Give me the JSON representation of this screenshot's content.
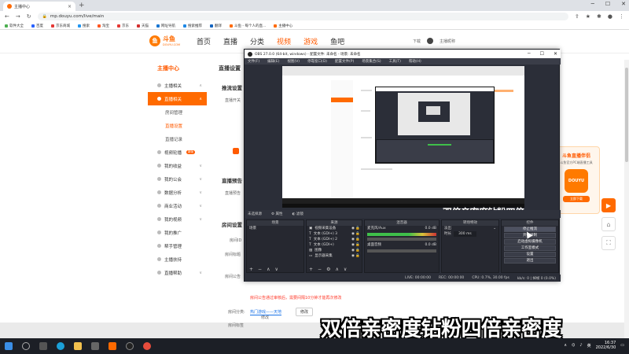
{
  "browser": {
    "tab_title": "主播中心",
    "url": "mp.douyu.com/live/main",
    "bookmarks": [
      "软件大全",
      "百度",
      "京东商城",
      "搜索",
      "淘宝",
      "京东",
      "天猫",
      "网址导航",
      "搜索推荐",
      "翻译",
      "斗鱼 - 每个人的直...",
      "主播中心"
    ]
  },
  "site": {
    "logo_text": "斗鱼",
    "logo_sub": "DOUYU.COM",
    "nav": [
      "首页",
      "直播",
      "分类",
      "视频",
      "游戏",
      "鱼吧"
    ],
    "download_label": "下载",
    "username": "主播昵称"
  },
  "sidebar": {
    "title": "主播中心",
    "items": [
      {
        "label": "主播相关",
        "chev": "∧"
      },
      {
        "label": "直播相关",
        "chev": "∧",
        "active": true
      },
      {
        "label": "房间管理"
      },
      {
        "label": "直播设置",
        "on": true
      },
      {
        "label": "直播记录"
      },
      {
        "label": "视频轮播",
        "badge": "新版"
      },
      {
        "label": "我的收益",
        "chev": "∨"
      },
      {
        "label": "我的公会",
        "chev": "∨"
      },
      {
        "label": "数据分析",
        "chev": "∨"
      },
      {
        "label": "商业活动",
        "chev": "∨"
      },
      {
        "label": "我的视频",
        "chev": "∨"
      },
      {
        "label": "我的推广"
      },
      {
        "label": "帮手管理"
      },
      {
        "label": "主播扶持"
      },
      {
        "label": "直播帮助",
        "chev": "∨"
      }
    ]
  },
  "content": {
    "title": "直播设置",
    "sec_push": "推流设置",
    "push_label": "直播开关",
    "sec_preview": "直播预告",
    "preview_label": "直播预告",
    "sec_room": "房间设置",
    "room_id": "房间ID",
    "room_name": "房间标题",
    "room_notice": "房间公告",
    "edit_btn": "修改",
    "warning": "房间公告通过审核后，需要间隔10分钟才能再次修改",
    "category_label": "房间分类:",
    "category_value": "热门游戏——天地",
    "category_btn": "修改",
    "tag_label": "房间标签"
  },
  "promo": {
    "title": "斗鱼直播伴侣",
    "subtitle": "斗鱼官方PC端直播工具",
    "app": "DOUYU",
    "download": "立即下载"
  },
  "obs": {
    "title": "OBS 27.0.0 (64-bit, windows) - 配置文件: 未命名 - 场景: 未命名",
    "menu": [
      "文件(F)",
      "编辑(E)",
      "视图(V)",
      "停靠窗口(D)",
      "配置文件(P)",
      "场景集合(S)",
      "工具(T)",
      "帮助(H)"
    ],
    "ctrlbar_label": "未选择源",
    "ctrlbar_props": "属性",
    "ctrlbar_filters": "滤镜",
    "docks": {
      "scenes": {
        "header": "场景",
        "items": [
          "场景"
        ]
      },
      "sources": {
        "header": "来源",
        "items": [
          "视频采集设备",
          "文本 (GDI+) 3",
          "文本 (GDI+) 2",
          "文本 (GDI+)",
          "图像",
          "显示器采集"
        ]
      },
      "mixer": {
        "header": "混音器",
        "tracks": [
          {
            "name": "麦克风/Aux",
            "db": "0.0 dB"
          },
          {
            "name": "桌面音频",
            "db": "0.0 dB"
          }
        ]
      },
      "transitions": {
        "header": "转场特效",
        "fade": "淡出",
        "duration_label": "时长",
        "duration": "300 ms"
      },
      "controls": {
        "header": "控件",
        "buttons": [
          "停止推流",
          "开始录制",
          "启动虚拟摄像机",
          "工作室模式",
          "设置",
          "退出"
        ]
      }
    },
    "status": [
      "LIVE: 00:00:00",
      "REC: 00:00:00",
      "CPU: 0.7%, 30.00 fps",
      "kb/s: 0 | 掉帧 0 (0.0%)"
    ]
  },
  "nested_caption": "双倍亲密度钻粉四倍亲密度",
  "caption": "双倍亲密度钻粉四倍亲密度",
  "taskbar": {
    "tray_lang": "英",
    "time": "16:37",
    "date": "2022/6/30"
  }
}
